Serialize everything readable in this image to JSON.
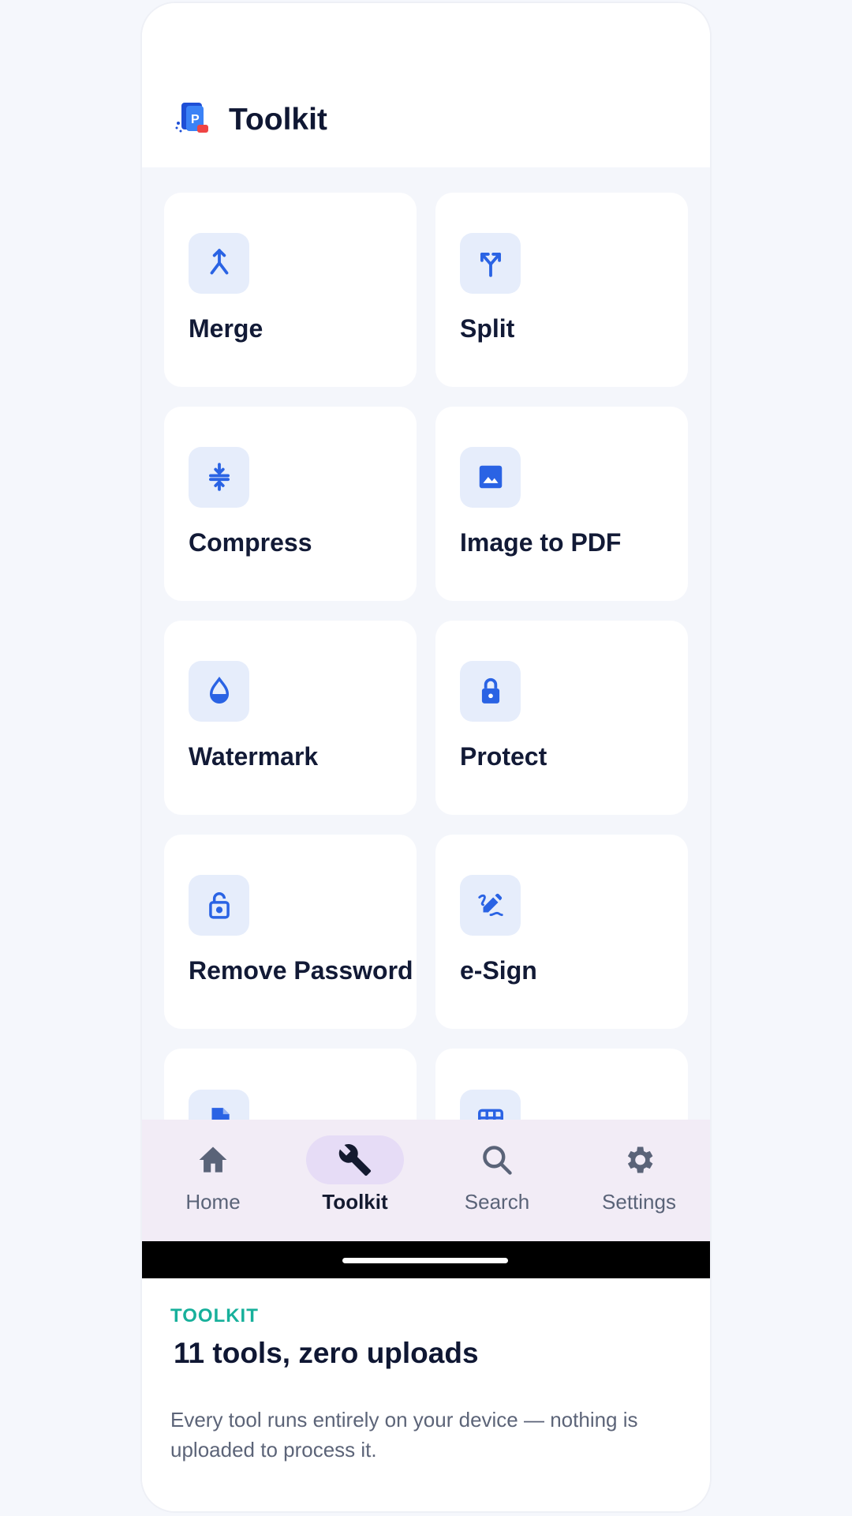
{
  "header": {
    "title": "Toolkit",
    "logo_icon": "pdf-logo-icon"
  },
  "tools": [
    {
      "label": "Merge",
      "icon": "merge-icon"
    },
    {
      "label": "Split",
      "icon": "split-icon"
    },
    {
      "label": "Compress",
      "icon": "compress-icon"
    },
    {
      "label": "Image to PDF",
      "icon": "image-icon"
    },
    {
      "label": "Watermark",
      "icon": "watermark-icon"
    },
    {
      "label": "Protect",
      "icon": "lock-icon"
    },
    {
      "label": "Remove Password",
      "icon": "unlock-icon"
    },
    {
      "label": "e-Sign",
      "icon": "signature-icon"
    },
    {
      "label": "",
      "icon": "document-icon"
    },
    {
      "label": "",
      "icon": "grid-icon"
    }
  ],
  "nav": {
    "items": [
      {
        "label": "Home",
        "icon": "home-icon"
      },
      {
        "label": "Toolkit",
        "icon": "wrench-icon",
        "active": true
      },
      {
        "label": "Search",
        "icon": "search-icon"
      },
      {
        "label": "Settings",
        "icon": "gear-icon"
      }
    ]
  },
  "footer": {
    "eyebrow": "TOOLKIT",
    "headline": "11 tools, zero uploads",
    "description": "Every tool runs entirely on your device — nothing is uploaded to process it."
  },
  "colors": {
    "accent_blue": "#2a63e4",
    "teal": "#17b09b",
    "nav_background": "#f2ecf6",
    "nav_active_pill": "#e6dcf6"
  }
}
